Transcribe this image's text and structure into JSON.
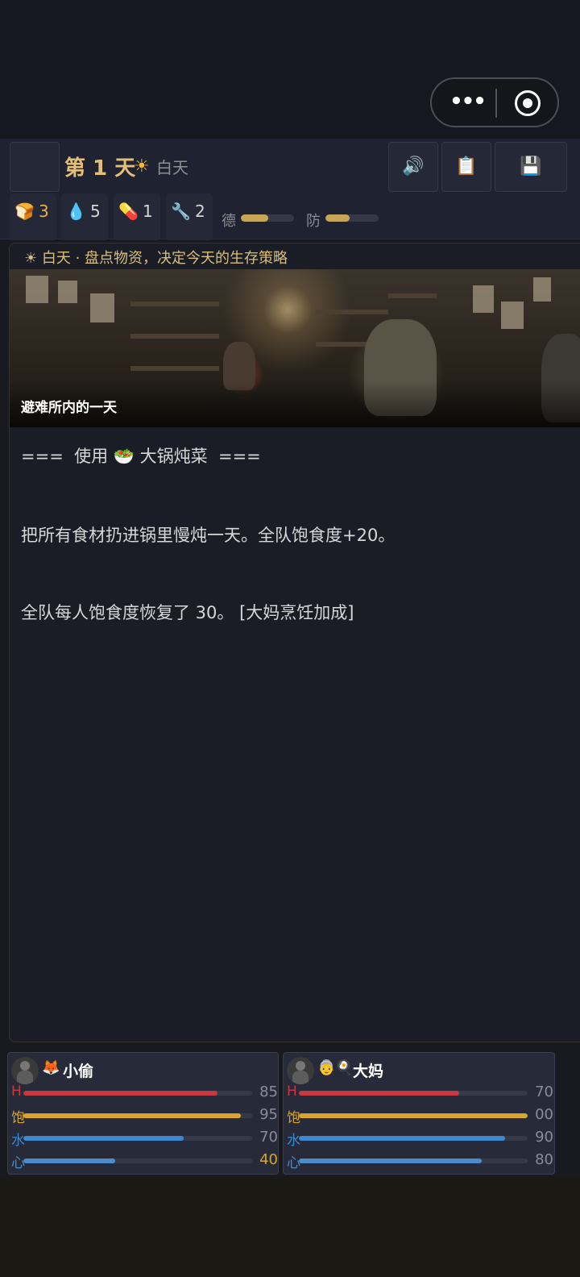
{
  "header": {
    "menu_icon": "",
    "day_title": "第 1 天",
    "sun_icon": "☀",
    "phase": "白天",
    "buttons": [
      {
        "name": "sound-button",
        "icon": "🔊"
      },
      {
        "name": "log-button",
        "icon": "📋"
      },
      {
        "name": "save-button",
        "icon": "💾"
      }
    ]
  },
  "capsule": {
    "more": "•••"
  },
  "resources": [
    {
      "icon": "🍞",
      "value": "3",
      "color": "#e3b04b"
    },
    {
      "icon": "💧",
      "value": "5",
      "color": "#cfcfd4"
    },
    {
      "icon": "💊",
      "value": "1",
      "color": "#cfcfd4"
    },
    {
      "icon": "🔧",
      "value": "2",
      "color": "#cfcfd4"
    }
  ],
  "meters": [
    {
      "label": "德",
      "fill": 0.52
    },
    {
      "label": "防",
      "fill": 0.45
    }
  ],
  "log": {
    "phase_line": "☀ 白天 · 盘点物资，决定今天的生存策略",
    "scene_caption": "避难所内的一天",
    "lines": [
      "===  使用 🥗 大锅炖菜  ===",
      "把所有食材扔进锅里慢炖一天。全队饱食度+20。",
      "全队每人饱食度恢复了 30。 [大妈烹饪加成]"
    ]
  },
  "stat_colors": {
    "H": "#c8393f",
    "饱": "#d9a52a",
    "水": "#3e8ad0",
    "心": "#4d8cc9"
  },
  "characters": [
    {
      "emoji": "🦊",
      "name": "小偷",
      "stats": [
        {
          "label": "H",
          "value": "85",
          "fill": 0.85,
          "val_color": "#8a8d97"
        },
        {
          "label": "饱",
          "value": "95",
          "fill": 0.95,
          "val_color": "#8a8d97"
        },
        {
          "label": "水",
          "value": "70",
          "fill": 0.7,
          "val_color": "#8a8d97"
        },
        {
          "label": "心",
          "value": "40",
          "fill": 0.4,
          "val_color": "#d9a52a"
        }
      ]
    },
    {
      "emoji": "👵🍳",
      "name": "大妈",
      "stats": [
        {
          "label": "H",
          "value": "70",
          "fill": 0.7,
          "val_color": "#8a8d97"
        },
        {
          "label": "饱",
          "value": "00",
          "fill": 1.0,
          "val_color": "#8a8d97"
        },
        {
          "label": "水",
          "value": "90",
          "fill": 0.9,
          "val_color": "#8a8d97"
        },
        {
          "label": "心",
          "value": "80",
          "fill": 0.8,
          "val_color": "#8a8d97"
        }
      ]
    }
  ]
}
